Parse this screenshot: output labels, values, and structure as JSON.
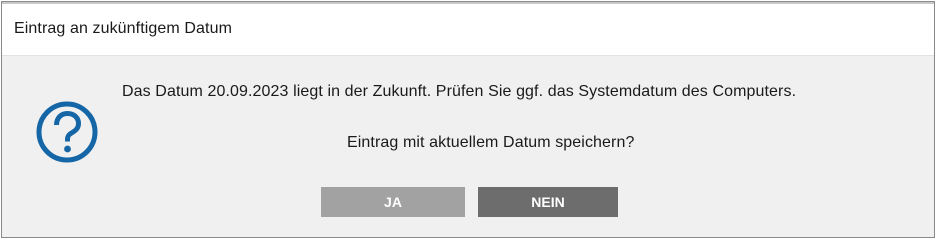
{
  "window": {
    "title": "Eintrag an zukünftigem Datum"
  },
  "dialog": {
    "icon": "question-icon",
    "message_line_1": "Das Datum 20.09.2023 liegt in der Zukunft. Prüfen Sie ggf. das Systemdatum des Computers.",
    "message_line_2": "Eintrag mit aktuellem Datum speichern?"
  },
  "buttons": {
    "yes_label": "JA",
    "no_label": "NEIN"
  },
  "colors": {
    "icon_blue": "#1466a6",
    "yes_button": "#a2a2a2",
    "no_button": "#6d6d6d",
    "dialog_background": "#f0f0f0",
    "title_background": "#ffffff"
  }
}
